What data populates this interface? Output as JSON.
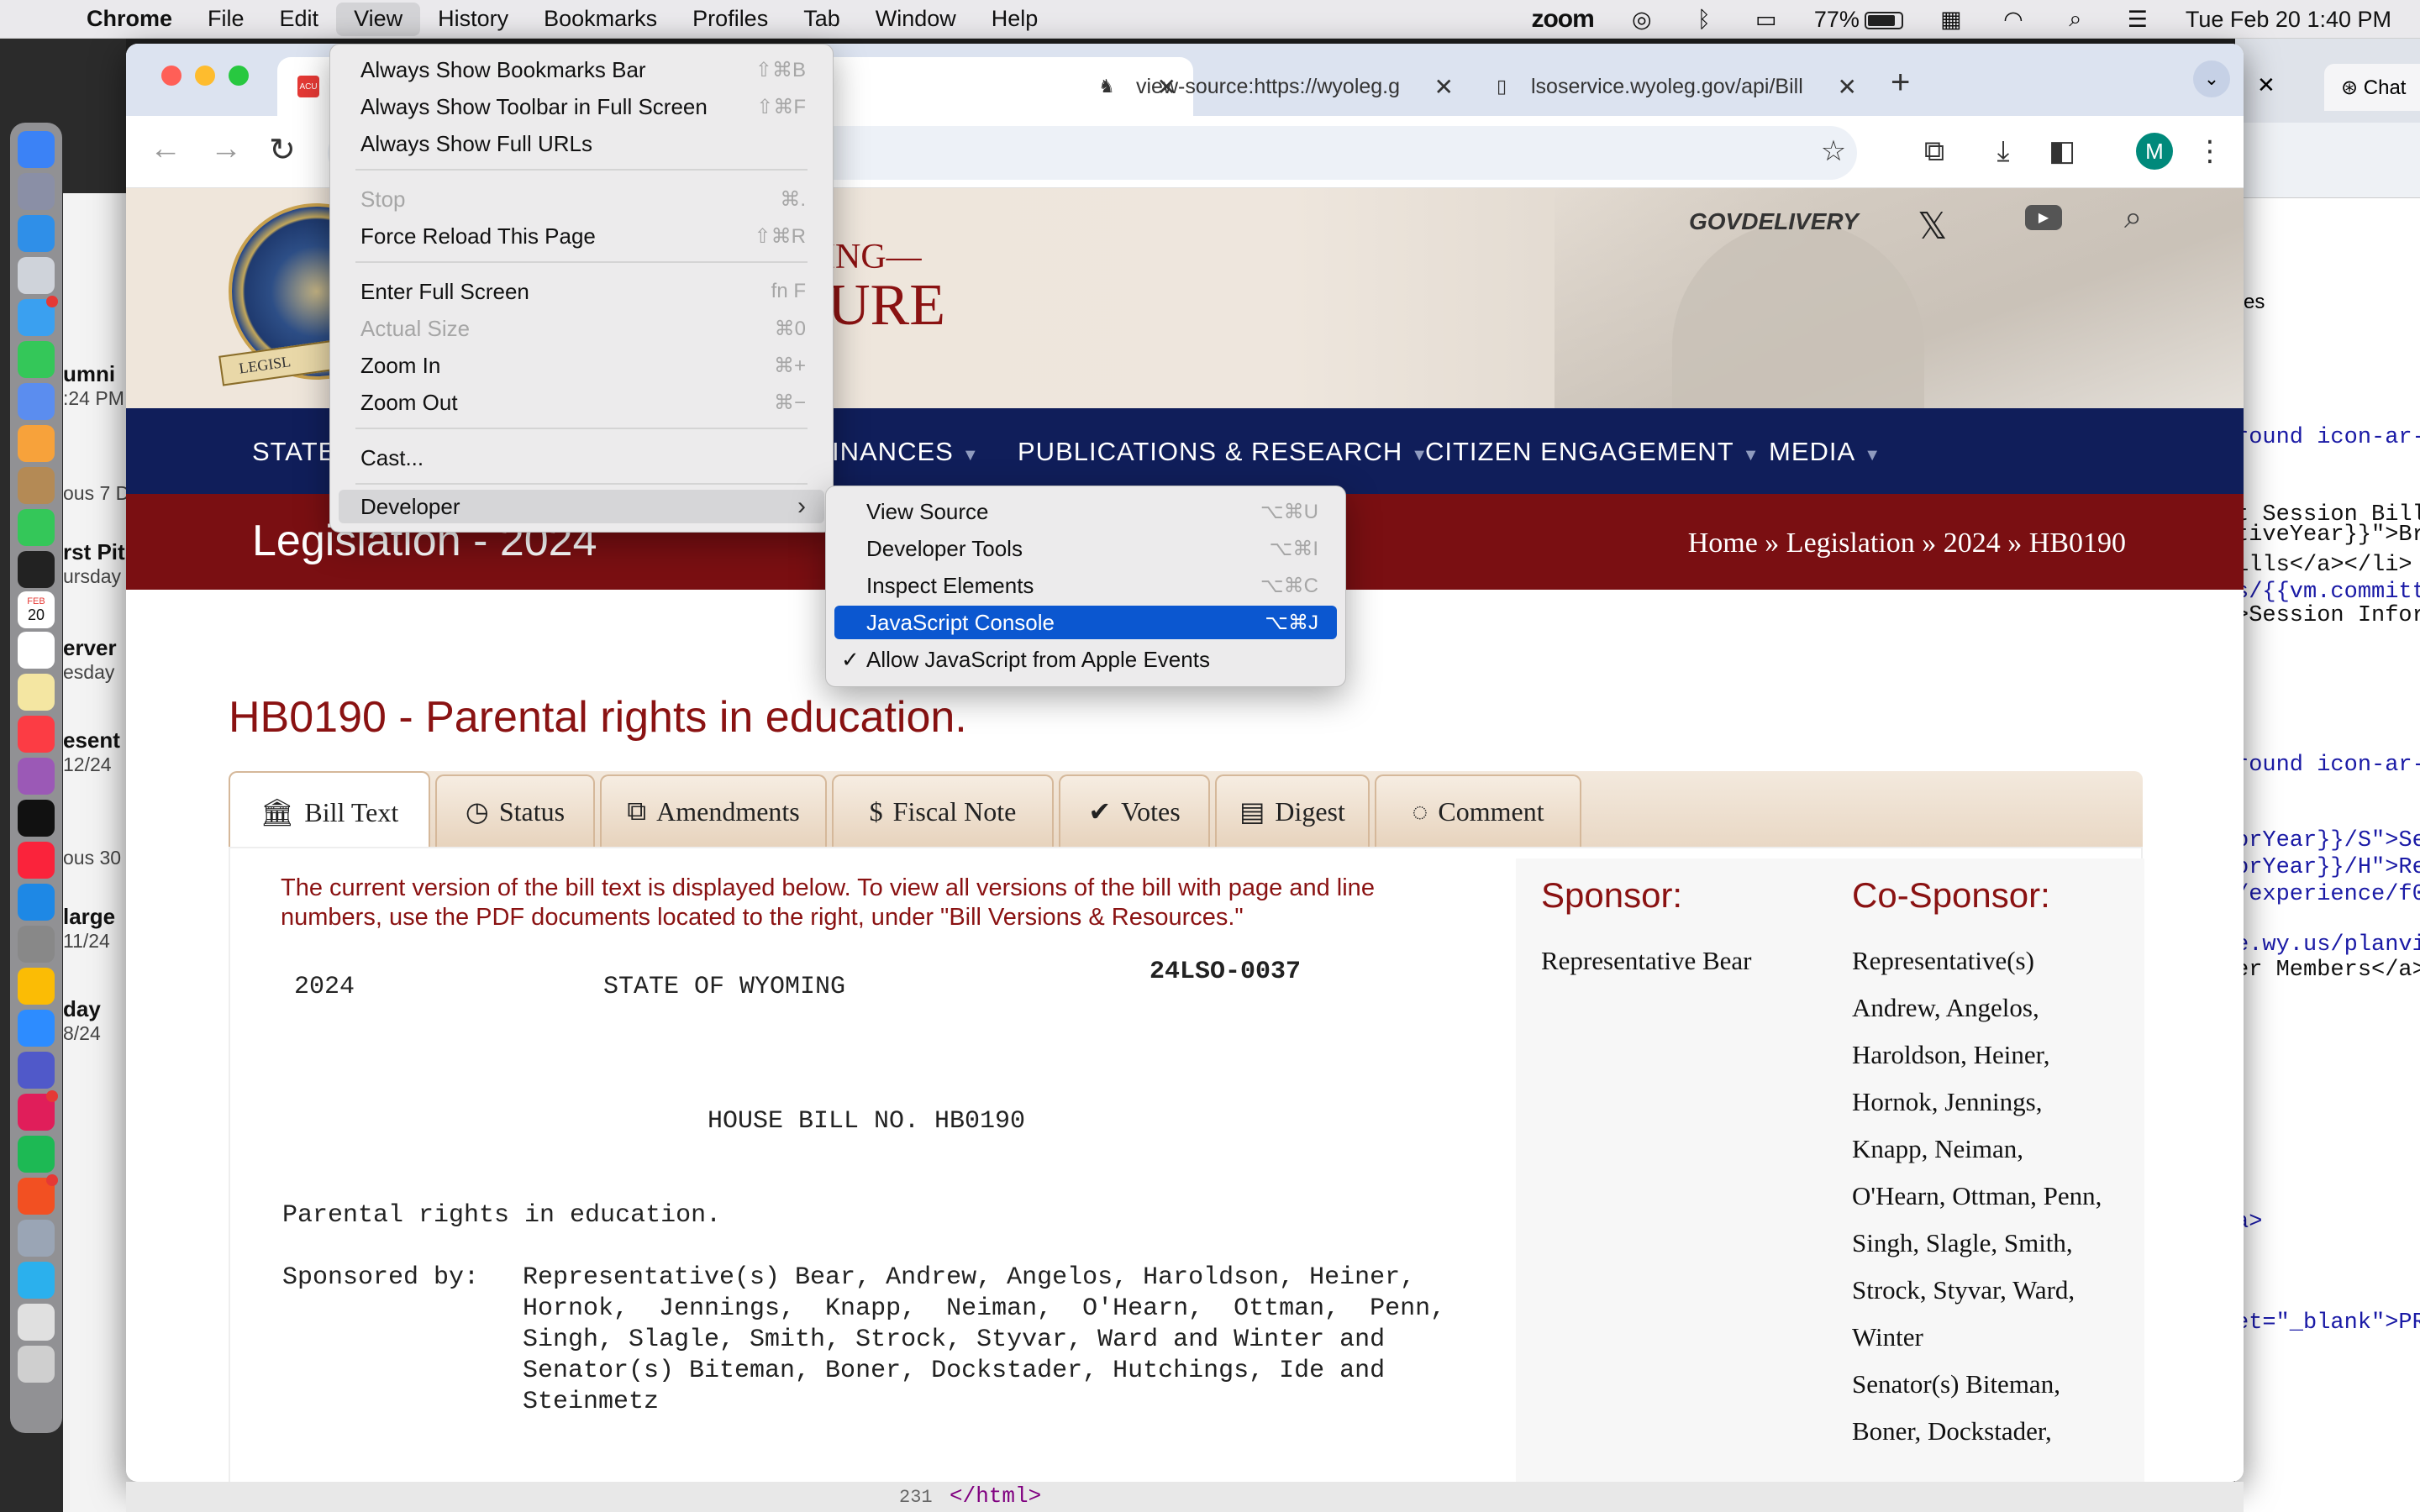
{
  "menubar": {
    "apple": "",
    "app_name": "Chrome",
    "items": [
      "File",
      "Edit",
      "View",
      "History",
      "Bookmarks",
      "Profiles",
      "Tab",
      "Window",
      "Help"
    ],
    "active_item": "View",
    "status": {
      "zoom": "zoom",
      "battery": "77%",
      "datetime": "Tue Feb 20  1:40 PM"
    }
  },
  "dock": {
    "date_month": "FEB",
    "date_day": "20"
  },
  "background_window": {
    "entries": [
      {
        "title": "umni",
        "sub": ":24 PM"
      },
      {
        "title": "",
        "sub": "ous 7 D"
      },
      {
        "title": "rst Pit",
        "sub": "ursday"
      },
      {
        "title": "erver",
        "sub": "esday"
      },
      {
        "title": "esent",
        "sub": "12/24"
      },
      {
        "title": "",
        "sub": "ous 30"
      },
      {
        "title": "large",
        "sub": "11/24"
      },
      {
        "title": "day",
        "sub": "8/24"
      }
    ]
  },
  "right_window": {
    "tab_label": "Chat",
    "es_text": "es",
    "code_lines": [
      "round icon-ar-",
      "t Session Bill",
      "tiveYear}}\">Br",
      "ills</a></li>",
      "s/{{vm.committ",
      ">Session Infor",
      "round icon-ar-",
      "orYear}}/S\">Se",
      "orYear}}/H\">Re",
      "/experience/f0",
      "e.wy.us/planvi",
      "er Members</a>",
      "a>",
      "et=\"_blank\">PR"
    ]
  },
  "browser": {
    "tabs": [
      {
        "label": "",
        "favicon": "acu-icon"
      },
      {
        "label": "view-source:https://wyoleg.g",
        "favicon": "cowboy-icon"
      },
      {
        "label": "lsoservice.wyoleg.gov/api/Bill",
        "favicon": "doc-icon"
      }
    ]
  },
  "site": {
    "logo_top": "ING—",
    "logo_bottom": "URE",
    "seal_ribbon": "LEGISL",
    "govdelivery": "GOVDELIVERY",
    "nav": [
      {
        "label": "STATE"
      },
      {
        "label": "INANCES"
      },
      {
        "label": "PUBLICATIONS & RESEARCH"
      },
      {
        "label": "CITIZEN ENGAGEMENT"
      },
      {
        "label": "MEDIA"
      }
    ],
    "section_title": "Legislation - 2024",
    "breadcrumb": "Home » Legislation » 2024 » HB0190",
    "bill_title": "HB0190 - Parental rights in education.",
    "bill_tabs": [
      {
        "label": "Bill Text",
        "icon": "bank-icon"
      },
      {
        "label": "Status",
        "icon": "clock-icon"
      },
      {
        "label": "Amendments",
        "icon": "copy-icon"
      },
      {
        "label": "Fiscal Note",
        "icon": "dollar-icon"
      },
      {
        "label": "Votes",
        "icon": "check-icon"
      },
      {
        "label": "Digest",
        "icon": "file-icon"
      },
      {
        "label": "Comment",
        "icon": "comment-icon"
      }
    ],
    "notice": "The current version of the bill text is displayed below. To view all versions of the bill with page and line numbers, use the PDF documents located to the right, under \"Bill Versions & Resources.\"",
    "bill_text": {
      "year": "2024",
      "state": "STATE OF WYOMING",
      "lso": "24LSO-0037",
      "house_bill": "HOUSE BILL NO. HB0190",
      "title_line": "Parental rights in education.",
      "sponsored_label": "Sponsored by:",
      "sponsored_lines": [
        "Representative(s) Bear, Andrew, Angelos, Haroldson, Heiner,",
        "Hornok,  Jennings,  Knapp,  Neiman,  O'Hearn,  Ottman,  Penn,",
        "Singh, Slagle, Smith, Strock, Styvar, Ward and Winter and",
        "Senator(s) Biteman, Boner, Dockstader, Hutchings, Ide and",
        "Steinmetz"
      ]
    },
    "sponsor_heading": "Sponsor:",
    "sponsor_name": "Representative Bear",
    "cosponsor_heading": "Co-Sponsor:",
    "cosponsor_lines": [
      "Representative(s)",
      "Andrew, Angelos,",
      "Haroldson, Heiner,",
      "Hornok, Jennings,",
      "Knapp, Neiman,",
      "O'Hearn, Ottman, Penn,",
      "Singh, Slagle, Smith,",
      "Strock, Styvar, Ward,",
      "Winter",
      "Senator(s) Biteman,",
      "Boner, Dockstader,"
    ]
  },
  "view_menu": {
    "items": [
      {
        "label": "Always Show Bookmarks Bar",
        "shortcut": "⇧⌘B",
        "disabled": false
      },
      {
        "label": "Always Show Toolbar in Full Screen",
        "shortcut": "⇧⌘F",
        "disabled": false
      },
      {
        "label": "Always Show Full URLs",
        "shortcut": "",
        "disabled": false
      },
      {
        "label": "Stop",
        "shortcut": "⌘.",
        "disabled": true
      },
      {
        "label": "Force Reload This Page",
        "shortcut": "⇧⌘R",
        "disabled": false
      },
      {
        "label": "Enter Full Screen",
        "shortcut": "fn F",
        "disabled": false
      },
      {
        "label": "Actual Size",
        "shortcut": "⌘0",
        "disabled": true
      },
      {
        "label": "Zoom In",
        "shortcut": "⌘+",
        "disabled": false
      },
      {
        "label": "Zoom Out",
        "shortcut": "⌘−",
        "disabled": false
      },
      {
        "label": "Cast...",
        "shortcut": "",
        "disabled": false
      },
      {
        "label": "Developer",
        "shortcut": "›",
        "disabled": false
      }
    ]
  },
  "developer_menu": {
    "items": [
      {
        "label": "View Source",
        "shortcut": "⌥⌘U"
      },
      {
        "label": "Developer Tools",
        "shortcut": "⌥⌘I"
      },
      {
        "label": "Inspect Elements",
        "shortcut": "⌥⌘C"
      },
      {
        "label": "JavaScript Console",
        "shortcut": "⌥⌘J"
      },
      {
        "label": "Allow JavaScript from Apple Events",
        "shortcut": "",
        "checked": "✓"
      }
    ]
  },
  "devtools_strip": {
    "line_number": "231",
    "tag": "</html>"
  }
}
